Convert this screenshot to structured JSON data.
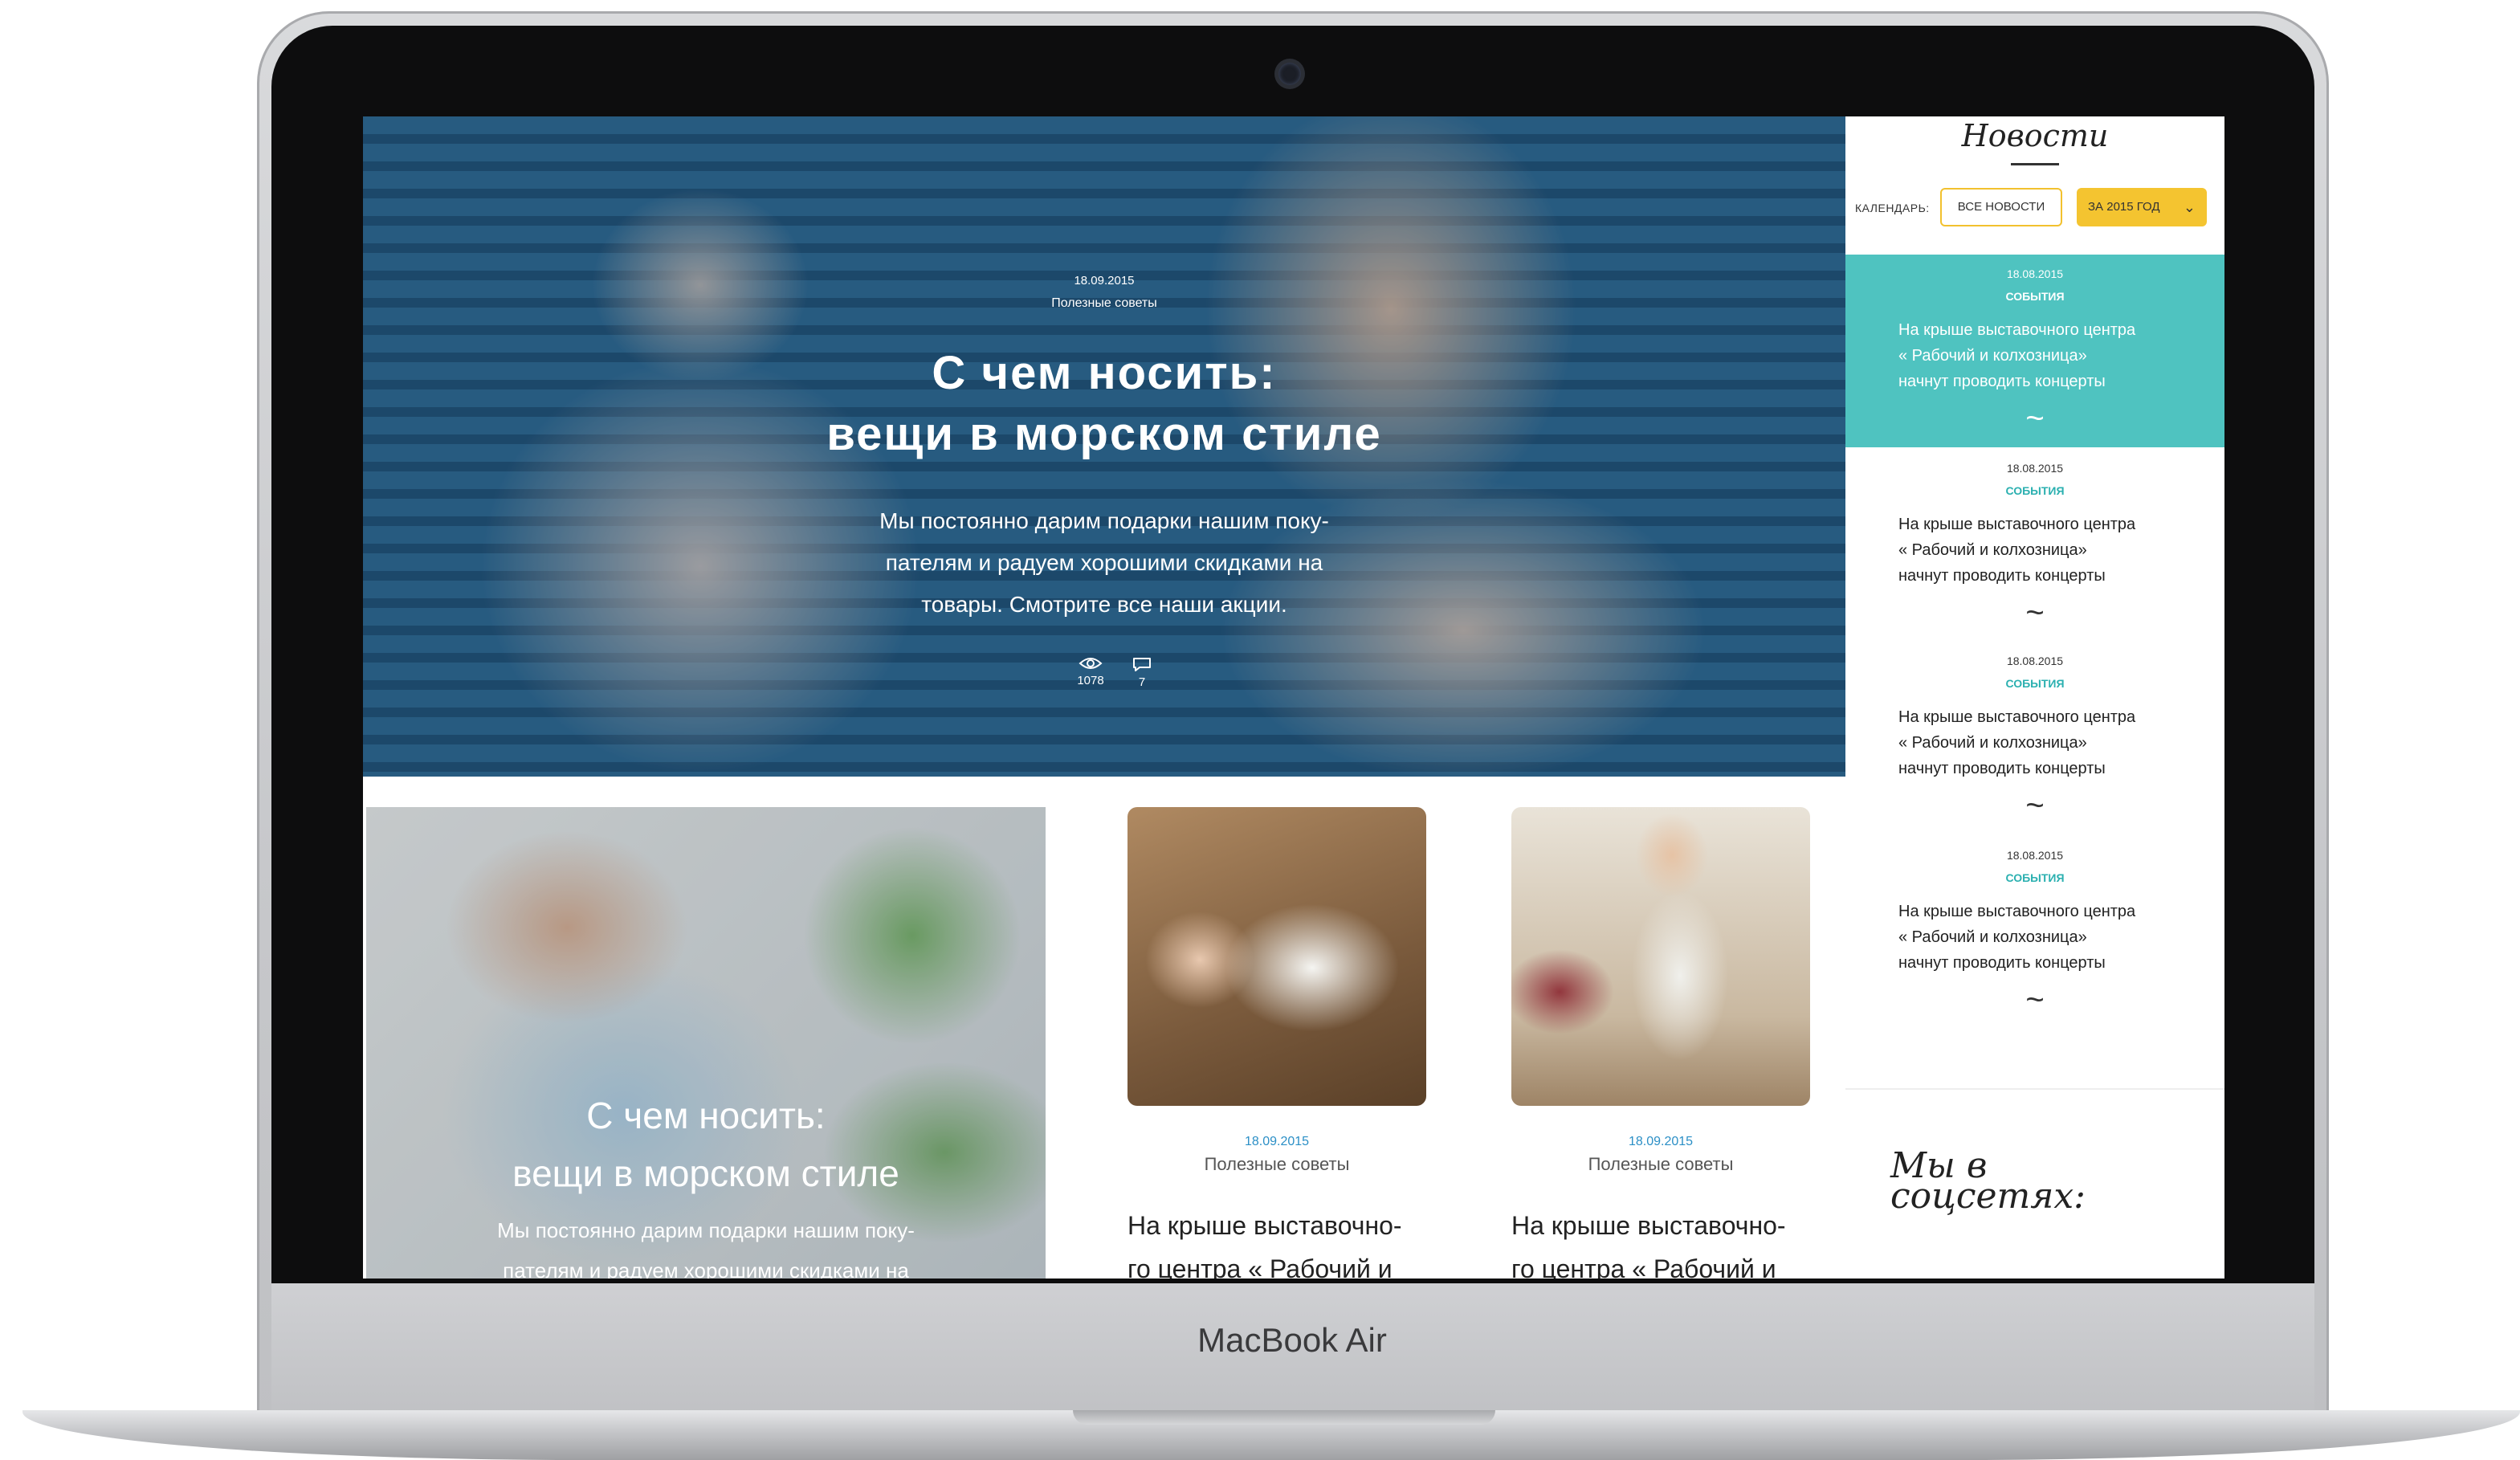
{
  "device": {
    "brand": "MacBook Air"
  },
  "hero": {
    "date": "18.09.2015",
    "category": "Полезные советы",
    "title_line1": "С чем носить:",
    "title_line2": "вещи в морском стиле",
    "text_line1": "Мы постоянно дарим подарки нашим поку-",
    "text_line2": "пателям и радуем хорошими скидками на",
    "text_line3": "товары. Смотрите все наши акции.",
    "views": "1078",
    "comments": "7"
  },
  "sidebar": {
    "title": "Новости",
    "calendar_label": "КАЛЕНДАРЬ:",
    "all_news_button": "ВСЕ НОВОСТИ",
    "year_button": "ЗА 2015 ГОД",
    "news": [
      {
        "date": "18.08.2015",
        "category": "СОБЫТИЯ",
        "line1": "На крыше выставочного центра",
        "line2": "« Рабочий и колхозница»",
        "line3": "начнут проводить концерты",
        "active": true
      },
      {
        "date": "18.08.2015",
        "category": "СОБЫТИЯ",
        "line1": "На крыше выставочного центра",
        "line2": "« Рабочий и колхозница»",
        "line3": "начнут проводить концерты",
        "active": false
      },
      {
        "date": "18.08.2015",
        "category": "СОБЫТИЯ",
        "line1": "На крыше выставочного центра",
        "line2": "« Рабочий и колхозница»",
        "line3": "начнут проводить концерты",
        "active": false
      },
      {
        "date": "18.08.2015",
        "category": "СОБЫТИЯ",
        "line1": "На крыше выставочного центра",
        "line2": "« Рабочий и колхозница»",
        "line3": "начнут проводить концерты",
        "active": false
      }
    ],
    "separator": "~",
    "social_title_line1": "Мы в",
    "social_title_line2": "соцсетях:"
  },
  "feature_card": {
    "title_line1": "С чем носить:",
    "title_line2": "вещи в морском стиле",
    "text_line1": "Мы постоянно дарим подарки нашим поку-",
    "text_line2": "пателям и радуем хорошими скидками на"
  },
  "cards": [
    {
      "date": "18.09.2015",
      "category": "Полезные советы",
      "title_line1": "На крыше выставочно-",
      "title_line2": "го центра « Рабочий и"
    },
    {
      "date": "18.09.2015",
      "category": "Полезные советы",
      "title_line1": "На крыше выставочно-",
      "title_line2": "го центра « Рабочий и"
    }
  ],
  "colors": {
    "accent_teal": "#4fc3c0",
    "accent_yellow": "#f4c430",
    "date_blue": "#2b8fc6"
  }
}
